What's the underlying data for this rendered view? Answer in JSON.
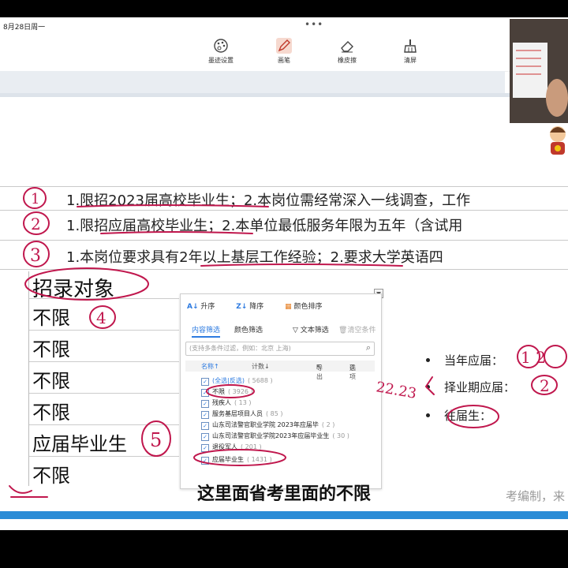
{
  "status": {
    "time": "8月28日周一",
    "dots": "•••"
  },
  "toolbar": {
    "tools": [
      {
        "label": "墨迹设置",
        "icon": "palette-icon"
      },
      {
        "label": "画笔",
        "icon": "pen-icon"
      },
      {
        "label": "橡皮擦",
        "icon": "eraser-icon"
      },
      {
        "label": "清屏",
        "icon": "broom-icon"
      }
    ]
  },
  "rows": [
    {
      "num": "1",
      "text": "1.限招2023届高校毕业生；2.本岗位需经常深入一线调查，工作"
    },
    {
      "num": "2",
      "text": "1.限招应届高校毕业生；2.本单位最低服务年限为五年（含试用"
    },
    {
      "num": "3",
      "text": "1.本岗位要求具有2年以上基层工作经验；2.要求大学英语四"
    }
  ],
  "column": {
    "header": "招录对象",
    "cells": [
      "不限",
      "不限",
      "不限",
      "不限",
      "应届毕业生",
      "不限"
    ]
  },
  "filter": {
    "sort_asc": "升序",
    "sort_desc": "降序",
    "sort_color": "颜色排序",
    "tab_content": "内容筛选",
    "tab_color": "颜色筛选",
    "tab_text": "文本筛选",
    "tab_clear": "清空条件",
    "search_placeholder": "(支持多条件过滤，例如：北京 上海)",
    "col_name": "名称↑",
    "col_count": "计数↓",
    "export": "导出",
    "options_btn": "选项",
    "options": [
      {
        "label": "(全选|反选)",
        "count": "( 5688 )",
        "checked": true
      },
      {
        "label": "不限",
        "count": "( 3926 )",
        "checked": true
      },
      {
        "label": "残疾人",
        "count": "( 13 )",
        "checked": true
      },
      {
        "label": "服务基层项目人员",
        "count": "( 85 )",
        "checked": true
      },
      {
        "label": "山东司法警官职业学院 2023年应届毕",
        "count": "( 2 )",
        "checked": true
      },
      {
        "label": "山东司法警官职业学院2023年应届毕业生",
        "count": "( 30 )",
        "checked": true
      },
      {
        "label": "退役军人",
        "count": "( 201 )",
        "checked": true
      },
      {
        "label": "应届毕业生",
        "count": "( 1431 )",
        "checked": true
      }
    ]
  },
  "bullets": [
    {
      "text": "当年应届：",
      "annot": "1 2"
    },
    {
      "text": "择业期应届：",
      "annot": "2"
    },
    {
      "text": "往届生：",
      "annot": ""
    }
  ],
  "annotations": {
    "circle4": "4",
    "circle5": "5",
    "side": "22.23"
  },
  "subtitle": "这里面省考里面的不限",
  "corner_text": "考编制，来",
  "colors": {
    "ink": "#c0174d",
    "accent": "#2e7be0",
    "bar": "#2a8cd6"
  }
}
